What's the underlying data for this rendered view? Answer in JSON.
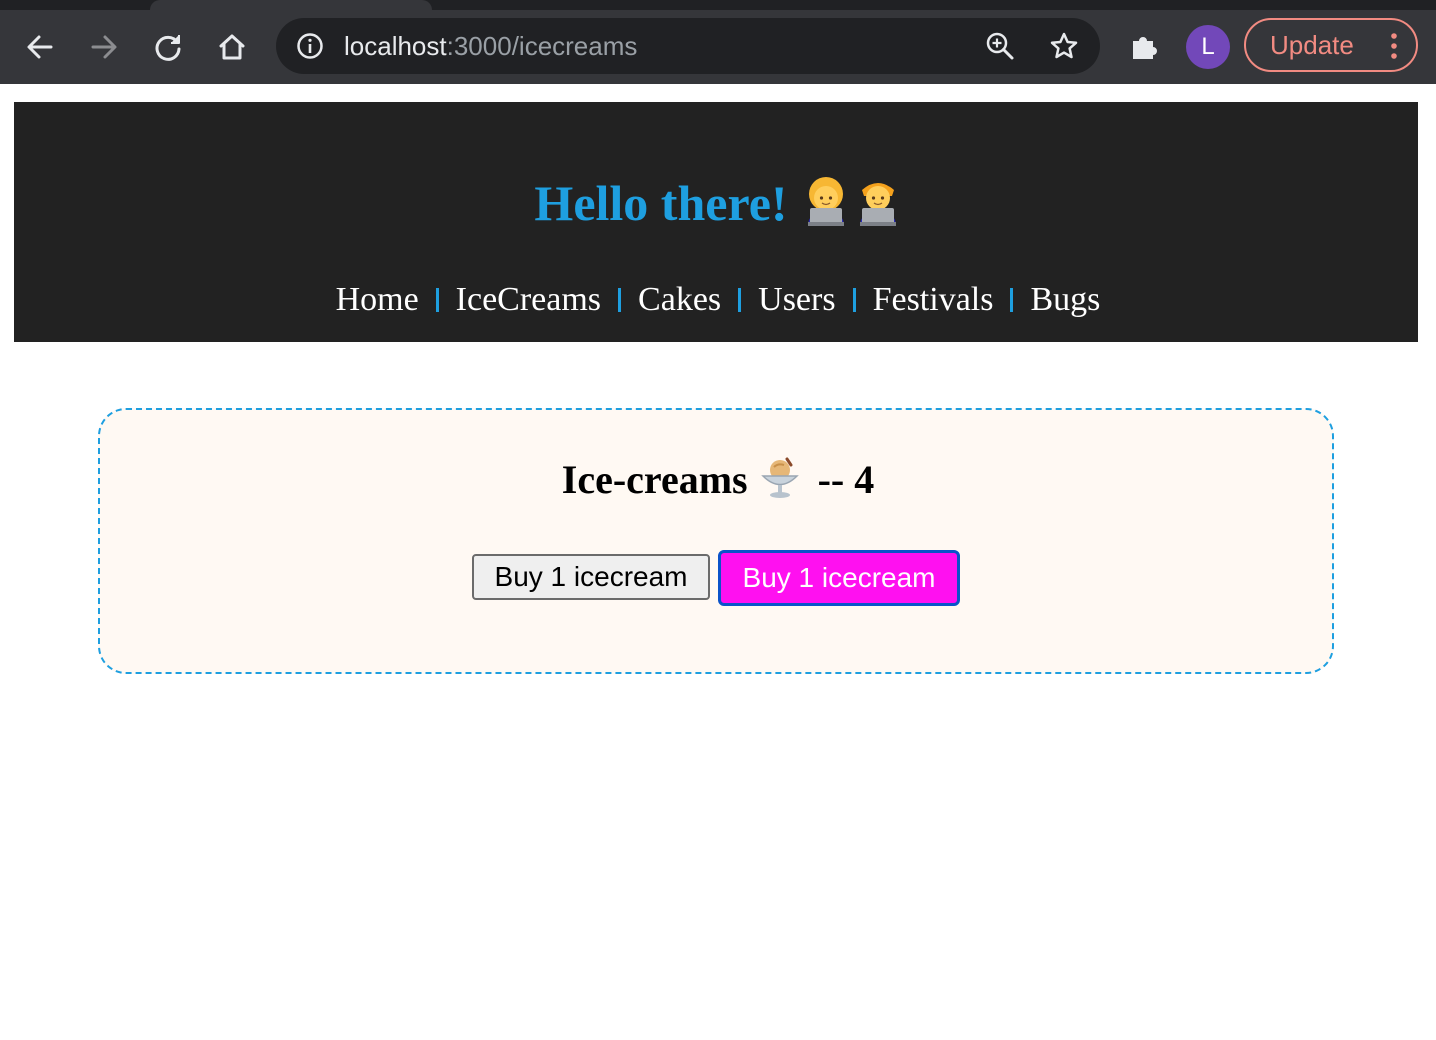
{
  "browser": {
    "url_host": "localhost",
    "url_path": ":3000/icecreams",
    "profile_initial": "L",
    "update_label": "Update",
    "colors": {
      "toolbar": "#35363a",
      "omnibox": "#202124",
      "update_accent": "#f28b82",
      "avatar": "#7248b9"
    },
    "icons": [
      "back-arrow-icon",
      "forward-arrow-icon",
      "reload-icon",
      "home-icon",
      "info-icon",
      "zoom-icon",
      "bookmark-star-icon",
      "extensions-puzzle-icon",
      "more-vert-icon"
    ]
  },
  "header": {
    "title": "Hello there!",
    "title_emoji": "technologist-pair-emoji",
    "nav": [
      "Home",
      "IceCreams",
      "Cakes",
      "Users",
      "Festivals",
      "Bugs"
    ],
    "colors": {
      "background": "#222222",
      "accent": "#1e9fe0",
      "text": "#ffffff"
    }
  },
  "main": {
    "card_title": "Ice-creams",
    "title_emoji": "ice-cream-sundae-emoji",
    "separator": "--",
    "count": "4",
    "buttons": [
      {
        "label": "Buy 1 icecream"
      },
      {
        "label": "Buy 1 icecream"
      }
    ],
    "colors": {
      "card_background": "#fff9f3",
      "card_border": "#1e9fe0",
      "pink_button": "#ff10f0",
      "pink_button_border": "#0b53c9"
    }
  }
}
